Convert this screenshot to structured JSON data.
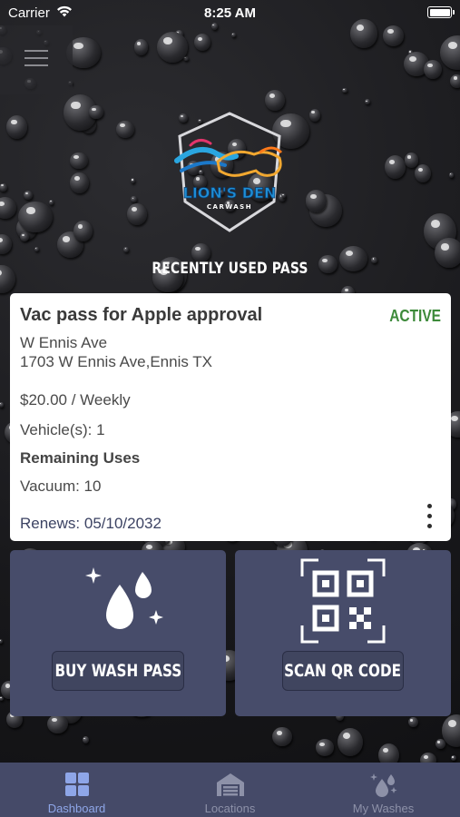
{
  "status_bar": {
    "carrier": "Carrier",
    "time": "8:25 AM"
  },
  "header": {
    "menu_icon": "hamburger-menu-icon",
    "logo_text": "LION'S DEN",
    "logo_subtext": "CARWASH"
  },
  "section_title": "RECENTLY USED PASS",
  "pass": {
    "name": "Vac pass for Apple approval",
    "status": "ACTIVE",
    "location_name": "W Ennis Ave",
    "address": "1703 W Ennis Ave,Ennis TX",
    "price": "$20.00 / Weekly",
    "vehicles": "Vehicle(s): 1",
    "remaining_uses_label": "Remaining Uses",
    "vacuum": "Vacuum: 10",
    "renews": "Renews: 05/10/2032"
  },
  "actions": {
    "buy_wash_pass": "BUY WASH PASS",
    "scan_qr_code": "SCAN QR CODE"
  },
  "tabs": [
    {
      "label": "Dashboard",
      "icon": "dashboard-grid-icon",
      "active": true
    },
    {
      "label": "Locations",
      "icon": "garage-icon",
      "active": false
    },
    {
      "label": "My Washes",
      "icon": "water-drops-icon",
      "active": false
    }
  ],
  "colors": {
    "card_background": "#ffffff",
    "active_status": "#3d8a3a",
    "tile_background": "#474c6a",
    "tab_bar_background": "#454a68",
    "tab_active": "#8ea6e8",
    "tab_inactive": "#8d91a8"
  }
}
